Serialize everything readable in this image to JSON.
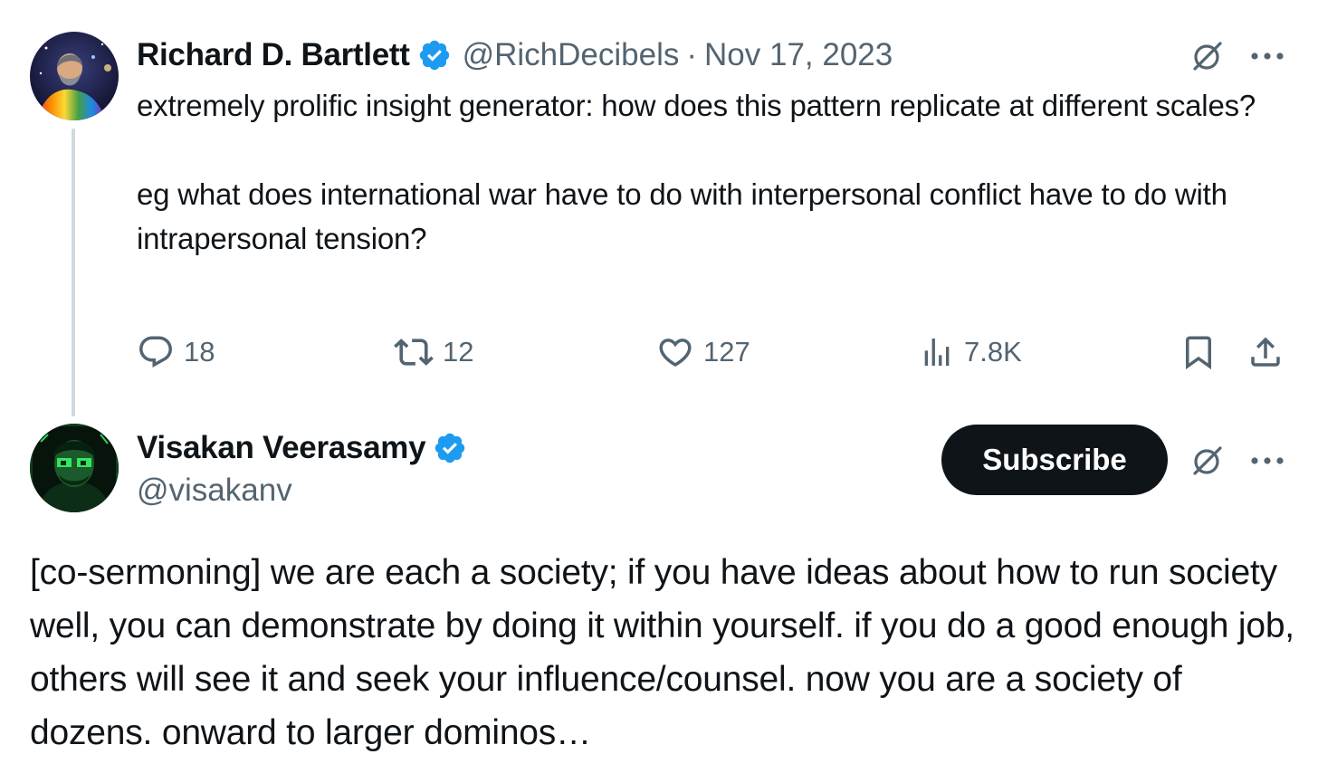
{
  "parent_tweet": {
    "author_name": "Richard D. Bartlett",
    "handle": "@RichDecibels",
    "separator": "·",
    "date": "Nov 17, 2023",
    "text_paragraphs": [
      "extremely prolific insight generator: how does this pattern replicate at different scales?",
      "eg what does international war have to do with interpersonal conflict have to do with intrapersonal tension?"
    ],
    "actions": {
      "replies": "18",
      "reposts": "12",
      "likes": "127",
      "views": "7.8K"
    }
  },
  "reply_tweet": {
    "author_name": "Visakan Veerasamy",
    "handle": "@visakanv",
    "subscribe_label": "Subscribe",
    "text": "[co-sermoning] we are each a society; if you have ideas about how to run society well, you can demonstrate by doing it within yourself. if you do a good enough job, others will see it and seek your influence/counsel. now you are a society of dozens. onward to larger dominos…"
  },
  "icons": {
    "verified": "verified-badge-icon",
    "grok": "grok-icon",
    "more": "more-icon",
    "reply": "reply-icon",
    "repost": "repost-icon",
    "like": "like-icon",
    "views": "views-icon",
    "bookmark": "bookmark-icon",
    "share": "share-icon"
  },
  "colors": {
    "text": "#0f1419",
    "muted": "#536471",
    "verified_blue": "#1d9bf0",
    "thread_line": "#cfd9de",
    "subscribe_bg": "#0f1419"
  }
}
